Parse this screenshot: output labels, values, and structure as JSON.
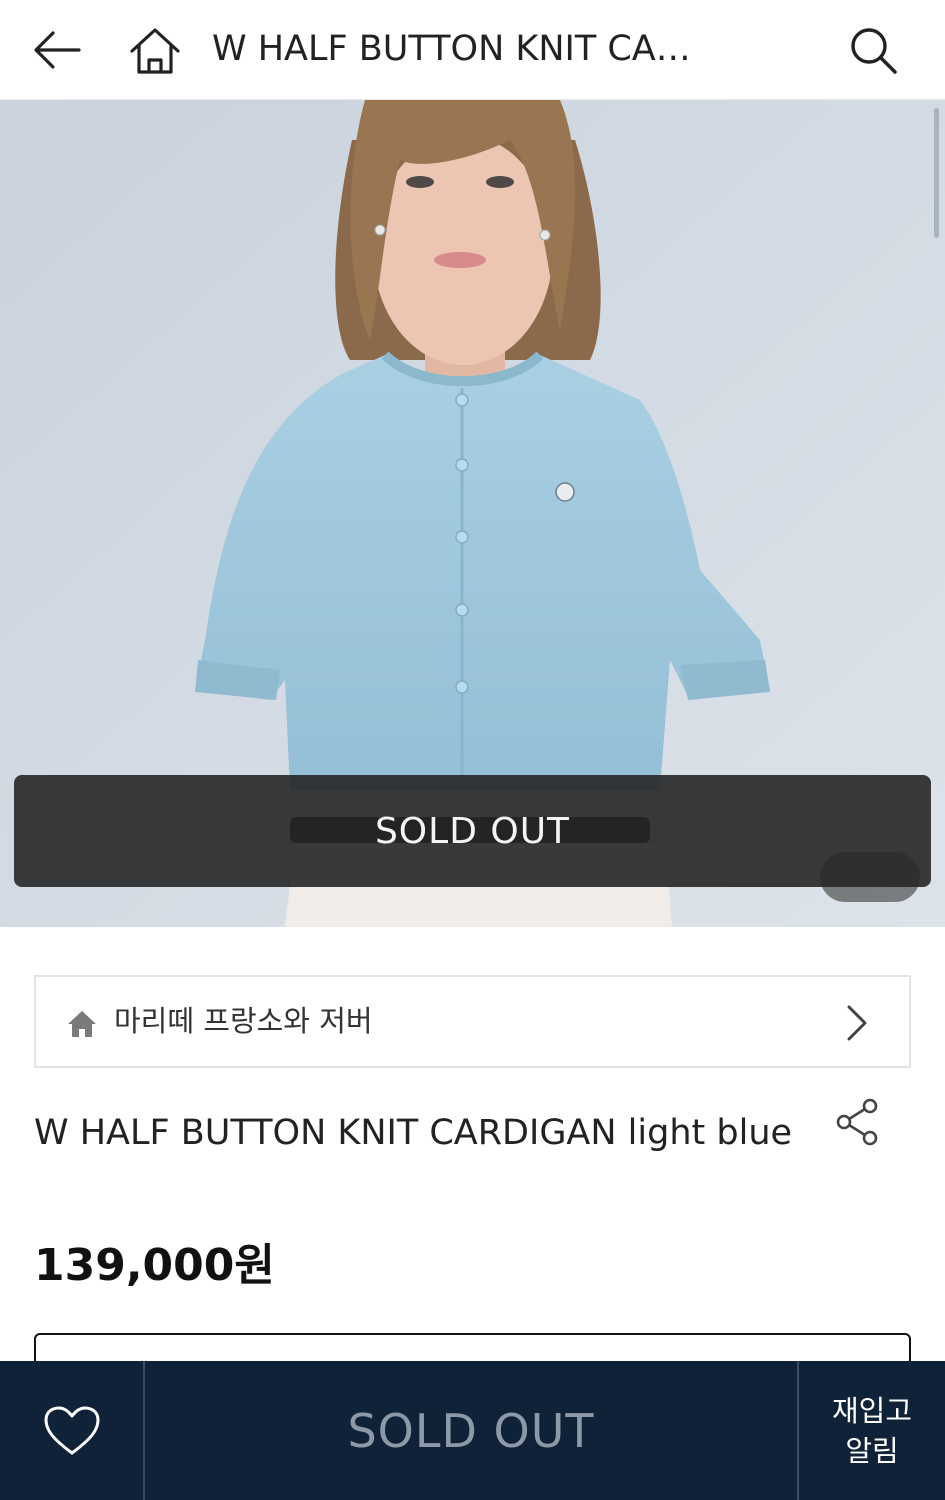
{
  "header": {
    "title": "W HALF BUTTON KNIT CA…",
    "back_icon": "arrow-left-icon",
    "home_icon": "home-icon",
    "search_icon": "search-icon"
  },
  "hero": {
    "image_desc": "product-photo",
    "sold_out_label": "SOLD OUT"
  },
  "brand": {
    "icon": "home-icon",
    "name": "마리떼 프랑소와 저버",
    "chevron_icon": "chevron-right-icon"
  },
  "product": {
    "title": "W HALF BUTTON KNIT CARDIGAN light blue",
    "price": "139,000원",
    "share_icon": "share-icon"
  },
  "bottom_bar": {
    "wish_icon": "heart-icon",
    "sold_out_label": "SOLD OUT",
    "restock_line1": "재입고",
    "restock_line2": "알림"
  },
  "colors": {
    "bottom_bar_bg": "#0f2238",
    "sold_out_banner_bg": "#262626",
    "sold_out_text_bottom": "#8e99a8"
  }
}
